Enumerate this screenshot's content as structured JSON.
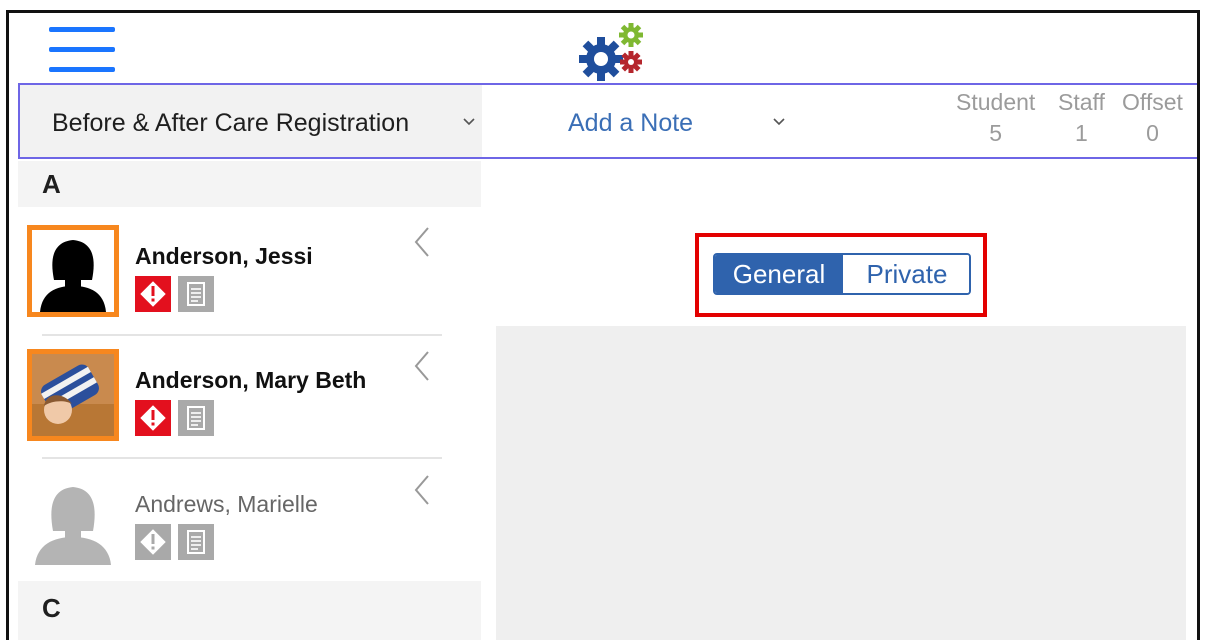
{
  "header": {
    "menu_icon": "hamburger-menu-icon",
    "logo_icon": "gears-logo-icon"
  },
  "toolbar": {
    "registration_label": "Before & After Care Registration",
    "add_note_label": "Add a Note",
    "stats": [
      {
        "label": "Student",
        "value": "5"
      },
      {
        "label": "Staff",
        "value": "1"
      },
      {
        "label": "Offset",
        "value": "0"
      }
    ]
  },
  "sidebar": {
    "sections": [
      {
        "letter": "A"
      },
      {
        "letter": "C"
      }
    ],
    "people": [
      {
        "name": "Anderson, Jessi"
      },
      {
        "name": "Anderson, Mary Beth"
      },
      {
        "name": "Andrews, Marielle"
      }
    ]
  },
  "note_type": {
    "options": [
      "General",
      "Private"
    ],
    "selected": "General"
  },
  "colors": {
    "accent_blue": "#2f63ad",
    "menu_blue": "#1a75ff",
    "avatar_border": "#f7871e",
    "alert_red": "#e3101e",
    "highlight_red": "#e30000",
    "toolbar_border": "#6e66e6"
  }
}
